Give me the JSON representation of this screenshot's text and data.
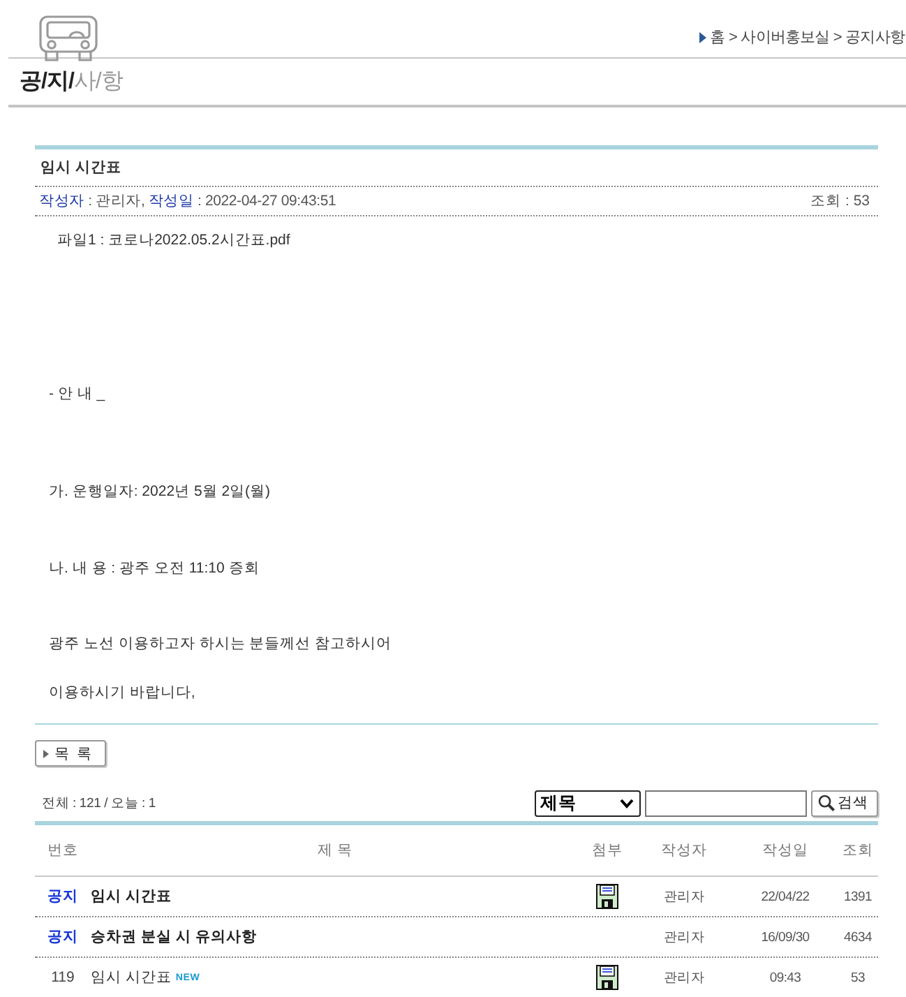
{
  "header": {
    "breadcrumb": "홈 > 사이버홍보실 > 공지사항"
  },
  "page_title": [
    {
      "text": "공/지/",
      "strong": true
    },
    {
      "text": "사/항",
      "strong": false
    }
  ],
  "article": {
    "title": "임시 시간표",
    "meta": [
      {
        "kind": "label",
        "text": "작성자"
      },
      {
        "kind": "value",
        "text": " : 관리자, "
      },
      {
        "kind": "label",
        "text": "작성일"
      },
      {
        "kind": "value",
        "text": " : 2022-04-27 09:43:51"
      }
    ],
    "views": "조회 : 53",
    "attachment": "파일1 : 코로나2022.05.2시간표.pdf",
    "body": [
      "- 안 내 _",
      "가. 운행일자: 2022년 5월 2일(월)",
      "나. 내 용 : 광주 오전 11:10 증회",
      "광주 노선 이용하고자 하시는 분들께선 참고하시어",
      "이용하시기 바랍니다,"
    ]
  },
  "list_button": "목 록",
  "stats": "전체 : 121 / 오늘 : 1",
  "search": {
    "type": "제목",
    "button": "검색"
  },
  "table": {
    "columns": [
      "번호",
      "제 목",
      "첨부",
      "작성자",
      "작성일",
      "조회"
    ],
    "rows": [
      {
        "kind": "notice",
        "number": "공지",
        "title": "임시 시간표",
        "attachment": true,
        "author": "관리자",
        "date": "22/04/22",
        "views": "1391"
      },
      {
        "kind": "notice",
        "number": "공지",
        "title": "승차권 분실 시 유의사항",
        "attachment": false,
        "author": "관리자",
        "date": "16/09/30",
        "views": "4634"
      },
      {
        "kind": "post",
        "number": "119",
        "title": "임시 시간표",
        "badge": "NEW",
        "attachment": true,
        "author": "관리자",
        "date": "09:43",
        "views": "53"
      }
    ]
  }
}
